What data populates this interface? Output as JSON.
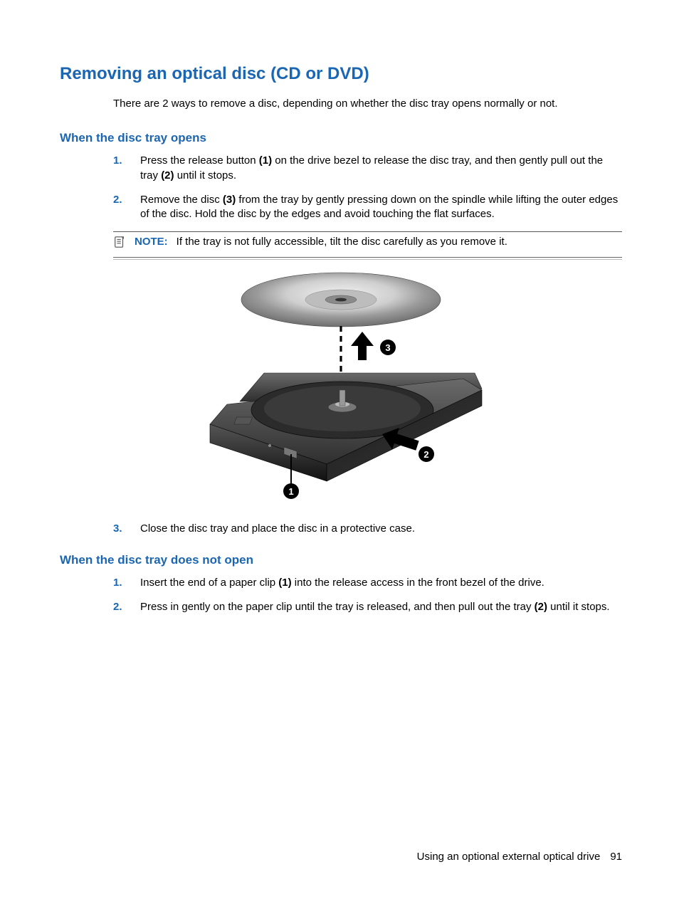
{
  "heading_main": "Removing an optical disc (CD or DVD)",
  "intro": "There are 2 ways to remove a disc, depending on whether the disc tray opens normally or not.",
  "section1": {
    "heading": "When the disc tray opens",
    "steps": {
      "s1": {
        "num": "1.",
        "t0": "Press the release button ",
        "b1": "(1)",
        "t1": " on the drive bezel to release the disc tray, and then gently pull out the tray ",
        "b2": "(2)",
        "t2": " until it stops."
      },
      "s2": {
        "num": "2.",
        "t0": "Remove the disc ",
        "b1": "(3)",
        "t1": " from the tray by gently pressing down on the spindle while lifting the outer edges of the disc. Hold the disc by the edges and avoid touching the flat surfaces."
      },
      "s3": {
        "num": "3.",
        "t0": "Close the disc tray and place the disc in a protective case."
      }
    },
    "note": {
      "label": "NOTE:",
      "text": "If the tray is not fully accessible, tilt the disc carefully as you remove it."
    }
  },
  "section2": {
    "heading": "When the disc tray does not open",
    "steps": {
      "s1": {
        "num": "1.",
        "t0": "Insert the end of a paper clip ",
        "b1": "(1)",
        "t1": " into the release access in the front bezel of the drive."
      },
      "s2": {
        "num": "2.",
        "t0": "Press in gently on the paper clip until the tray is released, and then pull out the tray ",
        "b1": "(2)",
        "t1": " until it stops."
      }
    }
  },
  "figure": {
    "callouts": {
      "one": "1",
      "two": "2",
      "three": "3"
    }
  },
  "footer": {
    "section": "Using an optional external optical drive",
    "page": "91"
  }
}
